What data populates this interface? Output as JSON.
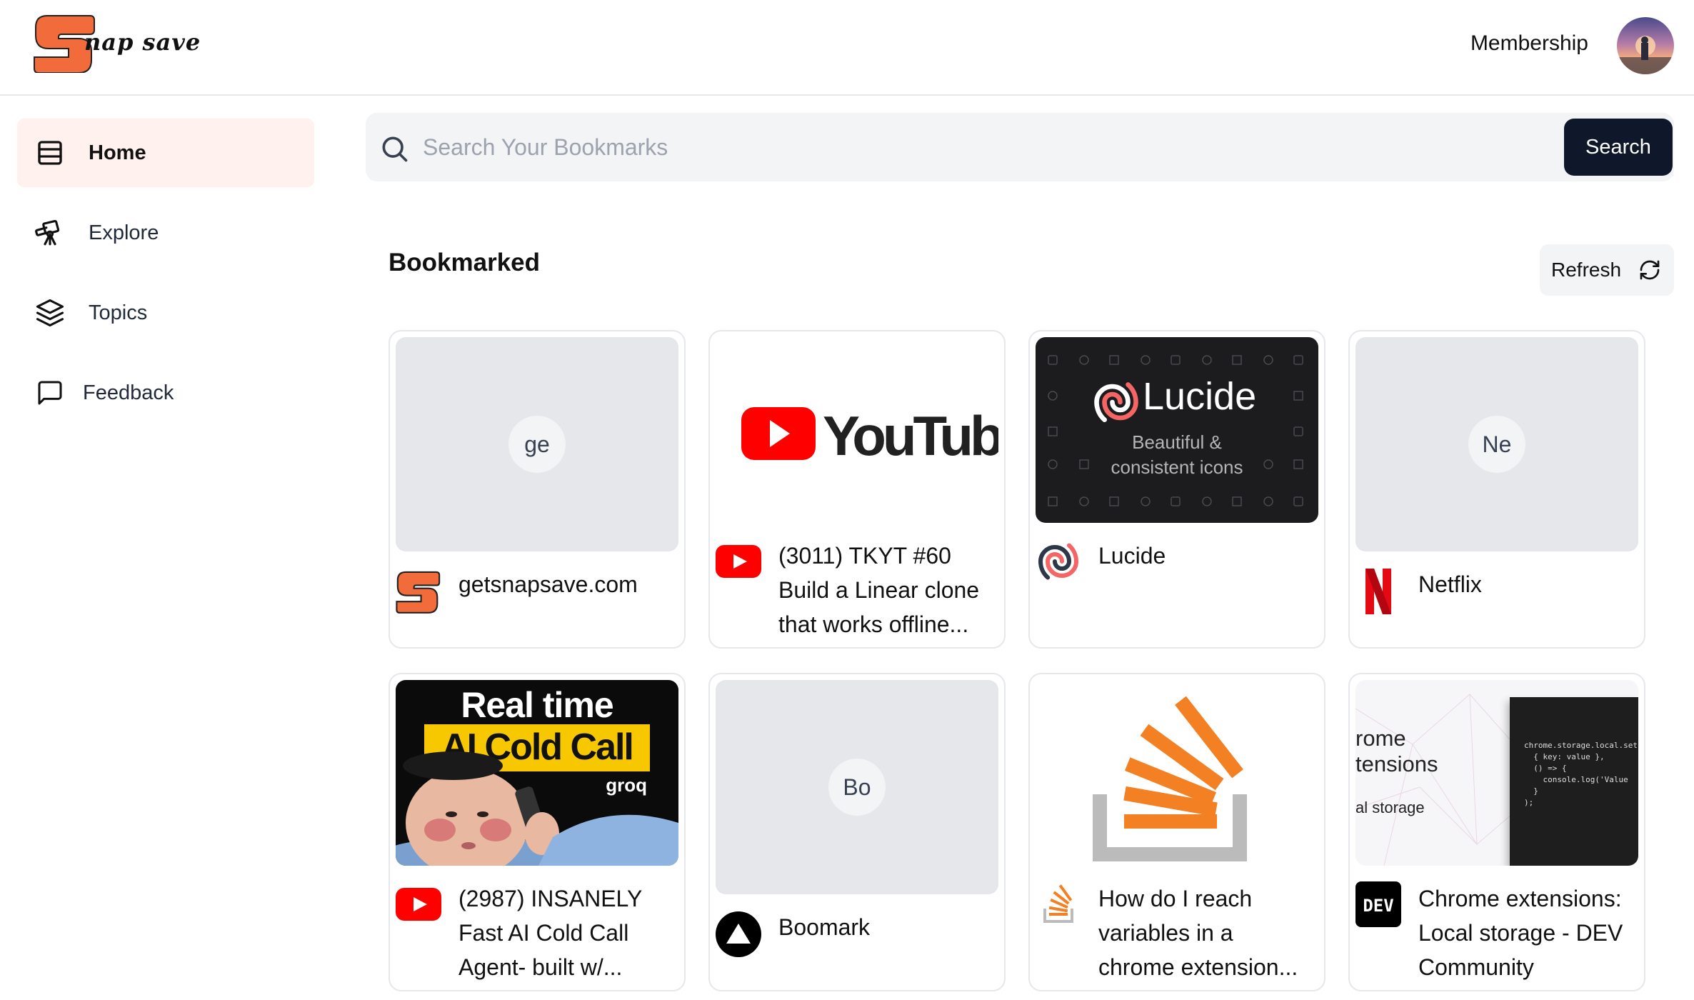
{
  "app": {
    "logo_text": "nap save",
    "membership_label": "Membership"
  },
  "sidebar": {
    "items": [
      {
        "label": "Home",
        "icon": "home-icon",
        "active": true
      },
      {
        "label": "Explore",
        "icon": "telescope-icon",
        "active": false
      },
      {
        "label": "Topics",
        "icon": "layers-icon",
        "active": false
      },
      {
        "label": "Feedback",
        "icon": "message-square-icon",
        "active": false
      }
    ]
  },
  "search": {
    "placeholder": "Search Your Bookmarks",
    "value": "",
    "button_label": "Search"
  },
  "section": {
    "title": "Bookmarked",
    "refresh_label": "Refresh"
  },
  "cards": [
    {
      "title": "getsnapsave.com",
      "initials": "ge",
      "favicon": "snapsave-icon"
    },
    {
      "title": "(3011) TKYT #60 Build a Linear clone that works offline...",
      "thumb_text": "YouTube",
      "favicon": "youtube-icon"
    },
    {
      "title": "Lucide",
      "thumb_text": "Lucide",
      "thumb_subtitle_1": "Beautiful &",
      "thumb_subtitle_2": "consistent icons",
      "favicon": "lucide-icon"
    },
    {
      "title": "Netflix",
      "initials": "Ne",
      "favicon": "netflix-icon"
    },
    {
      "title": "(2987) INSANELY Fast AI Cold Call Agent- built w/...",
      "thumb_text_1": "Real time",
      "thumb_text_2": "AI Cold Call",
      "thumb_text_3": "groq",
      "favicon": "youtube-icon"
    },
    {
      "title": "Boomark",
      "initials": "Bo",
      "favicon": "boomark-icon"
    },
    {
      "title": "How do I reach variables in a chrome extension...",
      "favicon": "stackoverflow-icon"
    },
    {
      "title": "Chrome extensions: Local storage - DEV Community",
      "thumb_text_1": "rome",
      "thumb_text_2": "tensions",
      "thumb_text_3": "al storage",
      "code": "chrome.storage.local.set(\n  { key: value },\n  () => {\n    console.log('Value\n  }\n);",
      "favicon": "dev-icon"
    }
  ],
  "colors": {
    "brand": "#f26b3a",
    "active_bg": "#fff1ee",
    "dark_button": "#0f172a",
    "youtube_red": "#ff0000",
    "netflix_red": "#e50914",
    "stack_orange": "#f48024"
  }
}
